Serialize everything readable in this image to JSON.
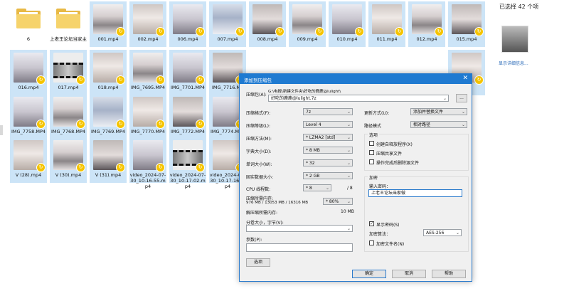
{
  "explorer": {
    "row1": [
      {
        "name": "6",
        "kind": "folder"
      },
      {
        "name": "上老王论坛当家主",
        "kind": "folder"
      },
      {
        "name": "001.mp4",
        "kind": "video",
        "c": "c1"
      },
      {
        "name": "002.mp4",
        "kind": "video",
        "c": "c2"
      },
      {
        "name": "006.mp4",
        "kind": "video",
        "c": "c3"
      },
      {
        "name": "007.mp4",
        "kind": "video",
        "c": "c5"
      },
      {
        "name": "008.mp4",
        "kind": "video",
        "c": "c4"
      },
      {
        "name": "009.mp4",
        "kind": "video",
        "c": "c1"
      },
      {
        "name": "010.mp4",
        "kind": "video",
        "c": "c3"
      },
      {
        "name": "011.mp4",
        "kind": "video",
        "c": "c2"
      },
      {
        "name": "012.mp4",
        "kind": "video",
        "c": "c1"
      },
      {
        "name": "015.mp4",
        "kind": "video",
        "c": "c4"
      }
    ],
    "row2": [
      {
        "name": "016.mp4",
        "kind": "video",
        "c": "c3"
      },
      {
        "name": "017.mp4",
        "kind": "film",
        "c": ""
      },
      {
        "name": "018.mp4",
        "kind": "video",
        "c": "c2"
      },
      {
        "name": "IMG_7695.MP4",
        "kind": "video",
        "c": "c1"
      },
      {
        "name": "IMG_7701.MP4",
        "kind": "video",
        "c": "c3"
      },
      {
        "name": "IMG_7716.MP",
        "kind": "video",
        "c": "c4"
      },
      {
        "name": "",
        "kind": "none",
        "c": ""
      },
      {
        "name": "",
        "kind": "none",
        "c": ""
      },
      {
        "name": "",
        "kind": "none",
        "c": ""
      },
      {
        "name": "",
        "kind": "none",
        "c": ""
      },
      {
        "name": "",
        "kind": "none",
        "c": ""
      },
      {
        "name": "MP4",
        "kind": "video",
        "c": "c2"
      }
    ],
    "row3": [
      {
        "name": "IMG_7758.MP4",
        "kind": "video",
        "c": "c3"
      },
      {
        "name": "IMG_7768.MP4",
        "kind": "video",
        "c": "c1"
      },
      {
        "name": "IMG_7769.MP4",
        "kind": "video",
        "c": "c5"
      },
      {
        "name": "IMG_7770.MP4",
        "kind": "video",
        "c": "c2"
      },
      {
        "name": "IMG_7772.MP4",
        "kind": "video",
        "c": "c4"
      },
      {
        "name": "IMG_7774.MP4",
        "kind": "video",
        "c": "c3"
      }
    ],
    "row4": [
      {
        "name": "V (28).mp4",
        "kind": "video",
        "c": "c2"
      },
      {
        "name": "V (30).mp4",
        "kind": "video",
        "c": "c1"
      },
      {
        "name": "V (31).mp4",
        "kind": "video",
        "c": "c4"
      },
      {
        "name": "video_2024-07-30_10-16-55.mp4",
        "kind": "video",
        "c": "c3"
      },
      {
        "name": "video_2024-07-30_10-17-02.mp4",
        "kind": "film",
        "c": ""
      },
      {
        "name": "video_2024-07-30_10-17-16.mp4",
        "kind": "video",
        "c": "c2"
      }
    ],
    "badge_icon": "cloud-sync-icon"
  },
  "right_panel": {
    "count_text": "已选择 42 个项",
    "details_link": "显示详细信息..."
  },
  "dialog": {
    "title": "添加到压缩包",
    "close_glyph": "✕",
    "archive_label": "压缩包(A):",
    "archive_path": "G:\\电报\\新建文件夹\\好吃的鹿鹿@lulight\\",
    "archive_name": "好吃的鹿鹿@lulight.7z",
    "browse_label": "...",
    "format_label": "压缩格式(F):",
    "format_value": "7z",
    "level_label": "压缩等级(L):",
    "level_value": "Level 4",
    "method_label": "压缩方法(M):",
    "method_value": "* LZMA2 [std]",
    "dict_label": "字典大小(D):",
    "dict_value": "* 8 MB",
    "word_label": "单词大小(W):",
    "word_value": "* 32",
    "solid_label": "固实数据大小:",
    "solid_value": "* 2 GB",
    "cpu_label": "CPU 线程数:",
    "cpu_value": "* 8",
    "cpu_max": "/ 8",
    "mem_comp_label": "压缩所需内存:",
    "mem_comp_value": "976 MB / 13053 MB / 16316 MB",
    "mem_pct": "* 80%",
    "mem_decomp_label": "解压缩所需内存:",
    "mem_decomp_value": "10 MB",
    "split_label": "分卷大小，字节(V):",
    "params_label": "参数(P):",
    "options_button": "选项",
    "update_label": "更新方式(U):",
    "update_value": "添加并替换文件",
    "path_label": "路径模式",
    "path_value": "相对路径",
    "options_group": "选项",
    "opt_sfx": "创建自释放程序(X)",
    "opt_shared": "压缩共享文件",
    "opt_delete": "操作完成后删除源文件",
    "enc_group": "加密",
    "pwd_label": "输入密码：",
    "pwd_value": "上老王论坛当家做",
    "show_pwd": "显示密码(S)",
    "enc_method_label": "加密算法：",
    "enc_method_value": "AES-256",
    "enc_names": "加密文件名(N)",
    "ok": "确定",
    "cancel": "取消",
    "help": "帮助"
  }
}
